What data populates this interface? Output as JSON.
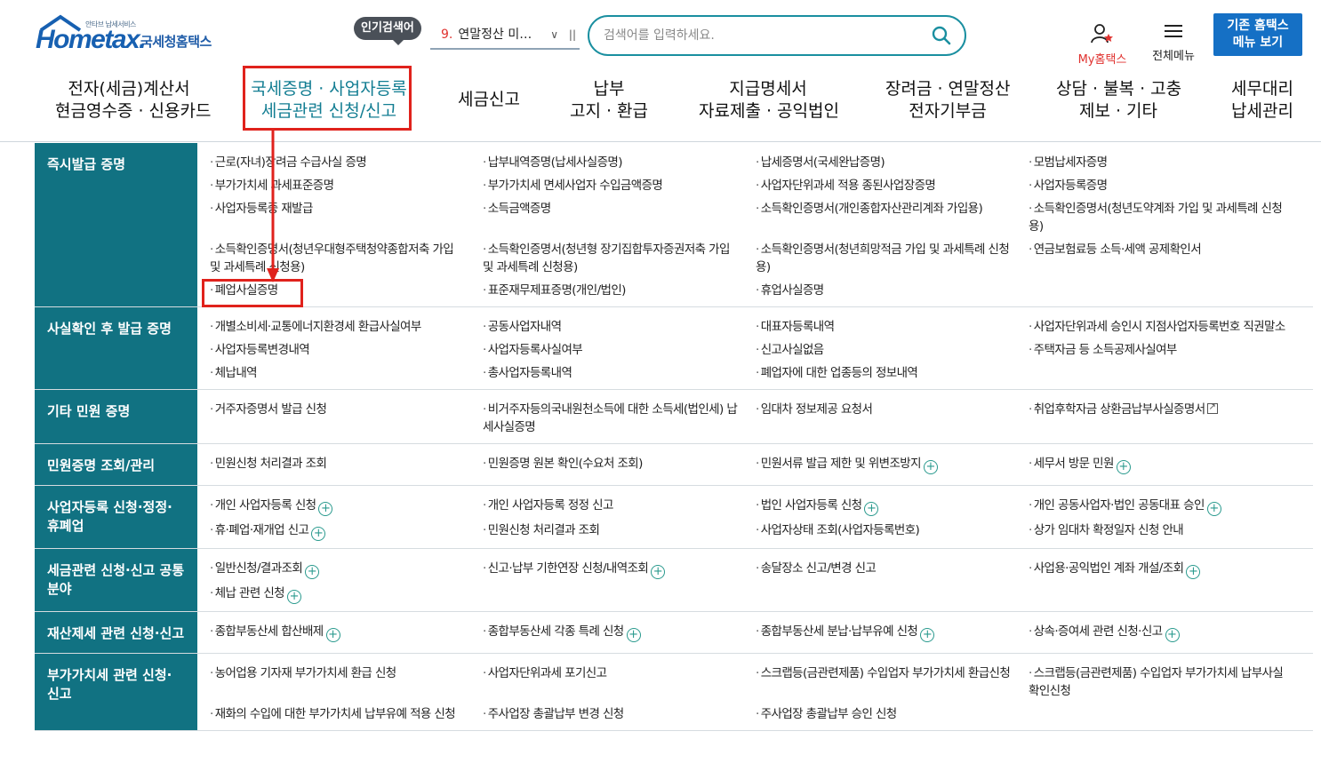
{
  "header": {
    "logo_small": "안타브 납세서비스",
    "logo_word": "Hometax.",
    "logo_kr": "국세청홈택스",
    "popular_label": "인기검색어",
    "popular_rank": "9.",
    "popular_term": "연말정산 미…",
    "search_placeholder": "검색어를 입력하세요.",
    "my_hometax": "My홈택스",
    "all_menu": "전체메뉴",
    "old_menu_line1": "기존 홈택스",
    "old_menu_line2": "메뉴 보기"
  },
  "gnb": [
    {
      "l1": "전자(세금)계산서",
      "l2": "현금영수증 · 신용카드"
    },
    {
      "l1": "국세증명 · 사업자등록",
      "l2": "세금관련 신청/신고"
    },
    {
      "l1": "세금신고",
      "l2": ""
    },
    {
      "l1": "납부",
      "l2": "고지 · 환급"
    },
    {
      "l1": "지급명세서",
      "l2": "자료제출 · 공익법인"
    },
    {
      "l1": "장려금 · 연말정산",
      "l2": "전자기부금"
    },
    {
      "l1": "상담 · 불복 · 고충",
      "l2": "제보 · 기타"
    },
    {
      "l1": "세무대리",
      "l2": "납세관리"
    }
  ],
  "rows": [
    {
      "head": "즉시발급 증명",
      "items": [
        "근로(자녀)장려금 수급사실 증명",
        "납부내역증명(납세사실증명)",
        "납세증명서(국세완납증명)",
        "모범납세자증명",
        "부가가치세 과세표준증명",
        "부가가치세 면세사업자 수입금액증명",
        "사업자단위과세 적용 종된사업장증명",
        "사업자등록증명",
        "사업자등록증 재발급",
        "소득금액증명",
        "소득확인증명서(개인종합자산관리계좌 가입용)",
        "소득확인증명서(청년도약계좌 가입 및 과세특례 신청용)",
        "소득확인증명서(청년우대형주택청약종합저축 가입 및 과세특례 신청용)",
        "소득확인증명서(청년형 장기집합투자증권저축 가입 및 과세특례 신청용)",
        "소득확인증명서(청년희망적금 가입 및 과세특례 신청용)",
        "연금보험료등 소득·세액 공제확인서",
        "폐업사실증명",
        "표준재무제표증명(개인/법인)",
        "휴업사실증명",
        ""
      ]
    },
    {
      "head": "사실확인 후 발급 증명",
      "items": [
        "개별소비세·교통에너지환경세 환급사실여부",
        "공동사업자내역",
        "대표자등록내역",
        "사업자단위과세 승인시 지점사업자등록번호 직권말소",
        "사업자등록변경내역",
        "사업자등록사실여부",
        "신고사실없음",
        "주택자금 등 소득공제사실여부",
        "체납내역",
        "총사업자등록내역",
        "폐업자에 대한 업종등의 정보내역",
        ""
      ]
    },
    {
      "head": "기타 민원 증명",
      "items": [
        "거주자증명서 발급 신청",
        "비거주자등의국내원천소득에 대한 소득세(법인세) 납세사실증명",
        "임대차 정보제공 요청서",
        "취업후학자금 상환금납부사실증명서"
      ]
    },
    {
      "head": "민원증명 조회/관리",
      "items": [
        "민원신청 처리결과 조회",
        "민원증명 원본 확인(수요처 조회)",
        "민원서류 발급 제한 및 위변조방지",
        "세무서 방문 민원"
      ]
    },
    {
      "head": "사업자등록 신청·정정· 휴폐업",
      "items": [
        "개인 사업자등록 신청",
        "개인 사업자등록 정정 신고",
        "법인 사업자등록 신청",
        "개인 공동사업자·법인 공동대표 승인",
        "휴·폐업·재개업 신고",
        "민원신청 처리결과 조회",
        "사업자상태 조회(사업자등록번호)",
        "상가 임대차 확정일자 신청 안내"
      ]
    },
    {
      "head": "세금관련 신청·신고 공통분야",
      "items": [
        "일반신청/결과조회",
        "신고·납부 기한연장 신청/내역조회",
        "송달장소 신고/변경 신고",
        "사업용·공익법인 계좌 개설/조회",
        "체납 관련 신청",
        "",
        "",
        ""
      ]
    },
    {
      "head": "재산제세 관련 신청·신고",
      "items": [
        "종합부동산세 합산배제",
        "종합부동산세 각종 특례 신청",
        "종합부동산세 분납·납부유예 신청",
        "상속·증여세 관련 신청·신고"
      ]
    },
    {
      "head": "부가가치세 관련 신청· 신고",
      "items": [
        "농어업용 기자재 부가가치세 환급 신청",
        "사업자단위과세 포기신고",
        "스크랩등(금관련제품) 수입업자 부가가치세 환급신청",
        "스크랩등(금관련제품) 수입업자 부가가치세 납부사실 확인신청",
        "재화의 수입에 대한 부가가치세 납부유예 적용 신청",
        "주사업장 총괄납부 변경 신청",
        "주사업장 총괄납부 승인 신청",
        ""
      ]
    }
  ],
  "plus_items": [
    "민원서류 발급 제한 및 위변조방지",
    "세무서 방문 민원",
    "개인 사업자등록 신청",
    "법인 사업자등록 신청",
    "개인 공동사업자·법인 공동대표 승인",
    "휴·폐업·재개업 신고",
    "일반신청/결과조회",
    "신고·납부 기한연장 신청/내역조회",
    "사업용·공익법인 계좌 개설/조회",
    "체납 관련 신청",
    "종합부동산세 합산배제",
    "종합부동산세 각종 특례 신청",
    "종합부동산세 분납·납부유예 신청",
    "상속·증여세 관련 신청·신고"
  ],
  "external_items": [
    "취업후학자금 상환금납부사실증명서"
  ],
  "colors": {
    "teal": "#117282",
    "highlight_red": "#e0221c",
    "button_blue": "#1570c5"
  }
}
